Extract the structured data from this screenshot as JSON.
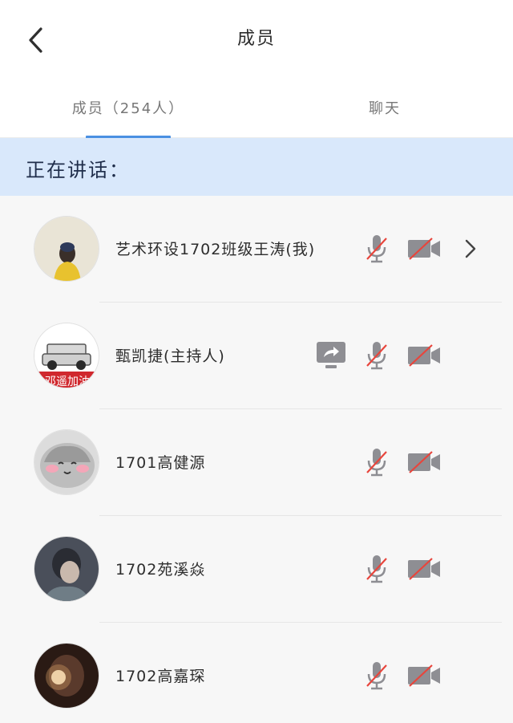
{
  "header": {
    "title": "成员"
  },
  "tabs": [
    {
      "label": "成员（254人）",
      "active": true
    },
    {
      "label": "聊天",
      "active": false
    }
  ],
  "speaking": {
    "label": "正在讲话："
  },
  "members": [
    {
      "name": "艺术环设1702班级王涛(我)",
      "role": "self",
      "mic_muted": true,
      "camera_off": true,
      "sharing": false,
      "has_detail": true
    },
    {
      "name": "甄凯捷(主持人)",
      "role": "host",
      "mic_muted": true,
      "camera_off": true,
      "sharing": true,
      "has_detail": false,
      "avatar_text": "邓遥加油"
    },
    {
      "name": "1701高健源",
      "role": "member",
      "mic_muted": true,
      "camera_off": true,
      "sharing": false,
      "has_detail": false
    },
    {
      "name": "1702苑溪焱",
      "role": "member",
      "mic_muted": true,
      "camera_off": true,
      "sharing": false,
      "has_detail": false
    },
    {
      "name": "1702高嘉琛",
      "role": "member",
      "mic_muted": true,
      "camera_off": true,
      "sharing": false,
      "has_detail": false
    }
  ],
  "colors": {
    "accent": "#4a90e2",
    "banner": "#d9e8fb",
    "icon_gray": "#8e8e93",
    "mute_red": "#e8453c"
  }
}
